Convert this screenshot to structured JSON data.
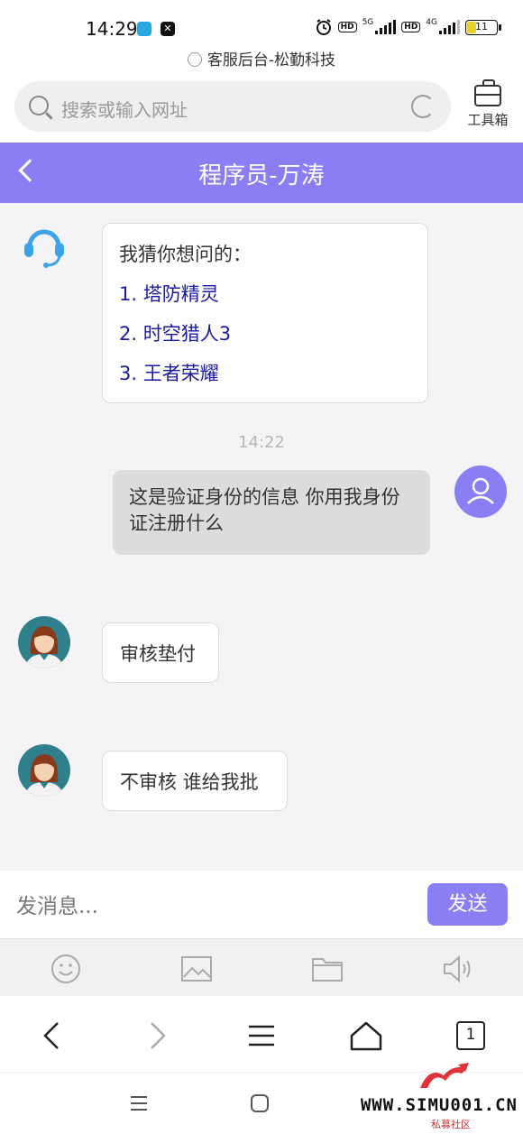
{
  "status_bar": {
    "time": "14:29",
    "network1": "5G",
    "network2": "4G",
    "hd": "HD",
    "battery": "11"
  },
  "browser": {
    "page_host": "客服后台-松勤科技",
    "search_placeholder": "搜索或输入网址",
    "toolbox_label": "工具箱"
  },
  "chat": {
    "title": "程序员-万涛",
    "messages": [
      {
        "from": "agent",
        "intro": "我猜你想问的：",
        "suggestions": [
          "1. 塔防精灵",
          "2. 时空猎人3",
          "3. 王者荣耀"
        ]
      },
      {
        "type": "timestamp",
        "text": "14:22"
      },
      {
        "from": "me",
        "text": "这是验证身份的信息 你用我身份证注册什么"
      },
      {
        "from": "staff",
        "text": "审核垫付"
      },
      {
        "from": "staff",
        "text": "不审核 谁给我批"
      }
    ]
  },
  "input": {
    "placeholder": "发消息...",
    "send_label": "发送"
  },
  "tabs_count": "1",
  "watermark": {
    "text": "WWW.SIMU001.CN",
    "sub": "私募社区"
  },
  "colors": {
    "accent": "#8a7ef5",
    "suggestion_link": "#1a1aa6"
  }
}
